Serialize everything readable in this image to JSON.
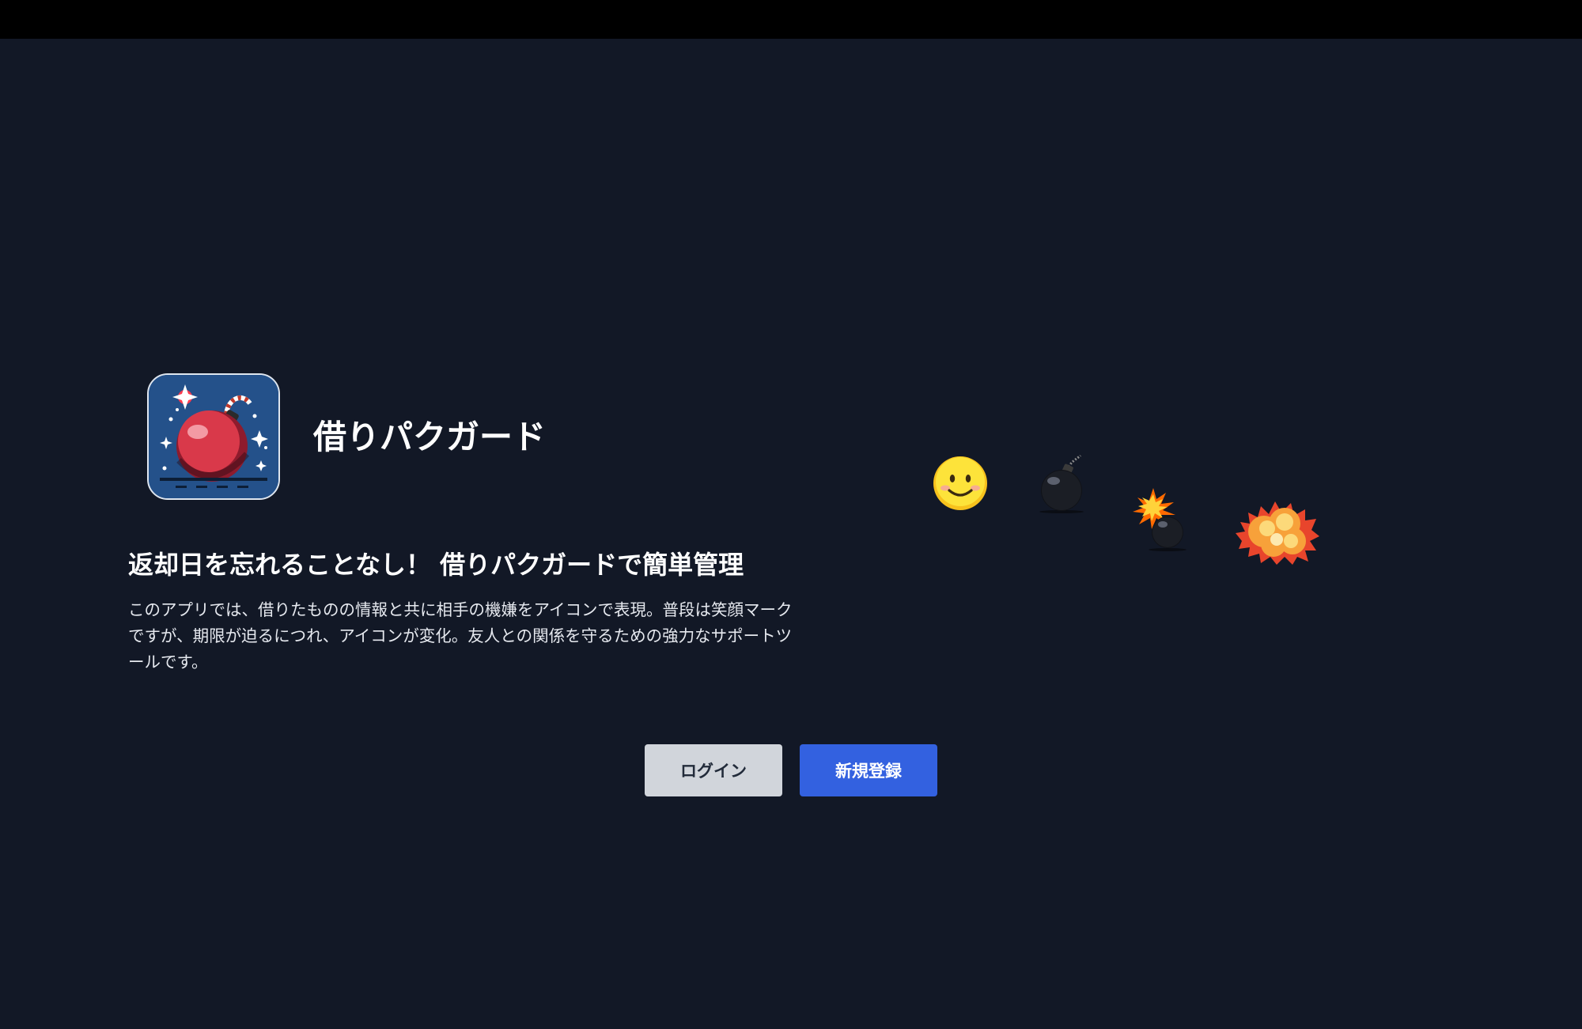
{
  "app": {
    "name": "借りパクガード"
  },
  "hero": {
    "headline": "返却日を忘れることなし！ 借りパクガードで簡単管理",
    "description": "このアプリでは、借りたものの情報と共に相手の機嫌をアイコンで表現。普段は笑顔マークですが、期限が迫るにつれ、アイコンが変化。友人との関係を守るための強力なサポートツールです。"
  },
  "status_icons": [
    "smiley-face-icon",
    "bomb-icon",
    "bomb-lit-fuse-icon",
    "explosion-icon"
  ],
  "actions": {
    "login_label": "ログイン",
    "signup_label": "新規登録"
  },
  "colors": {
    "background": "#121826",
    "topbar": "#000000",
    "login_button": "#d1d5db",
    "signup_button": "#3361e0"
  }
}
